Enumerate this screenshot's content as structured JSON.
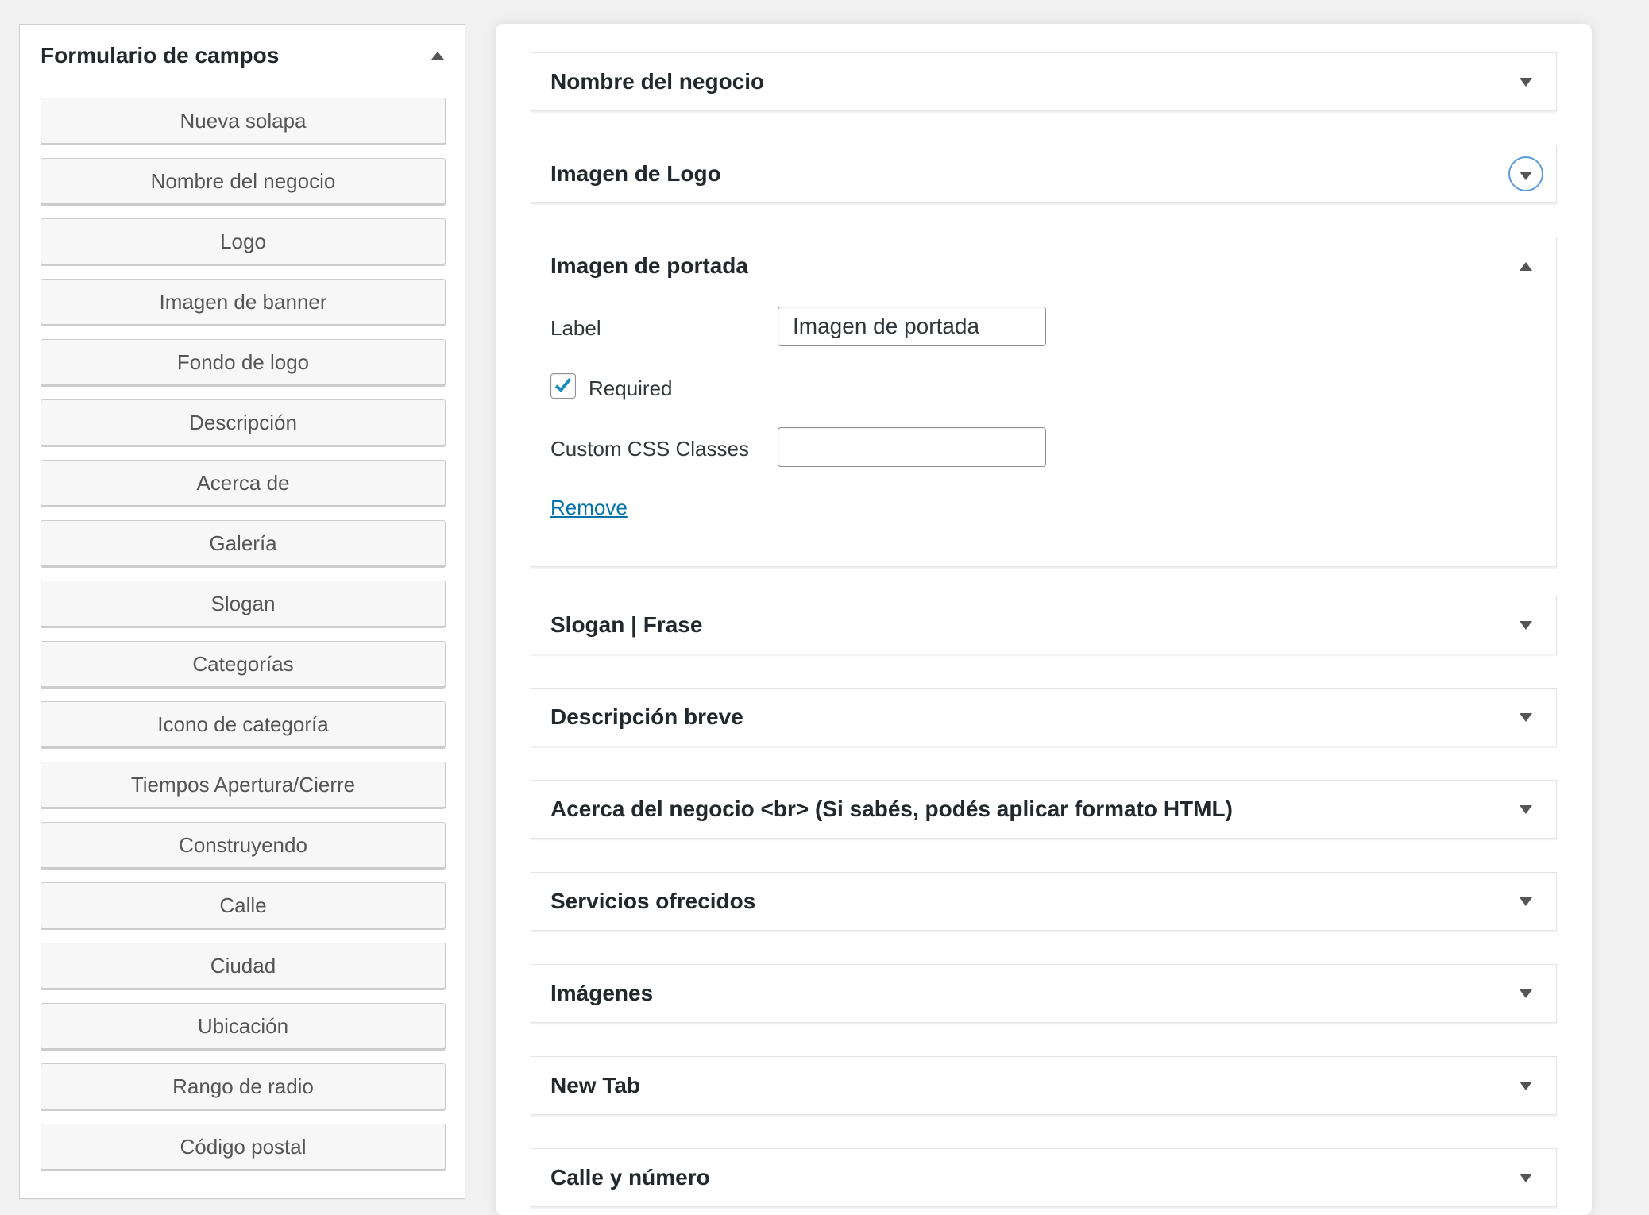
{
  "sidebar": {
    "title": "Formulario de campos",
    "buttons": [
      "Nueva solapa",
      "Nombre del negocio",
      "Logo",
      "Imagen de banner",
      "Fondo de logo",
      "Descripción",
      "Acerca de",
      "Galería",
      "Slogan",
      "Categorías",
      "Icono de categoría",
      "Tiempos Apertura/Cierre",
      "Construyendo",
      "Calle",
      "Ciudad",
      "Ubicación",
      "Rango de radio",
      "Código postal"
    ]
  },
  "fields": [
    {
      "title": "Nombre del negocio",
      "state": "collapsed"
    },
    {
      "title": "Imagen de Logo",
      "state": "collapsed-focused"
    },
    {
      "title": "Imagen de portada",
      "state": "expanded",
      "label_label": "Label",
      "label_value": "Imagen de portada",
      "required_label": "Required",
      "required_checked": true,
      "css_label": "Custom CSS Classes",
      "css_value": "",
      "remove_label": "Remove"
    },
    {
      "title": "Slogan | Frase",
      "state": "collapsed"
    },
    {
      "title": "Descripción breve",
      "state": "collapsed"
    },
    {
      "title": "Acerca del negocio <br> (Si sabés, podés aplicar formato HTML)",
      "state": "collapsed"
    },
    {
      "title": "Servicios ofrecidos",
      "state": "collapsed"
    },
    {
      "title": "Imágenes",
      "state": "collapsed"
    },
    {
      "title": "New Tab",
      "state": "collapsed"
    },
    {
      "title": "Calle y número",
      "state": "collapsed"
    }
  ],
  "colors": {
    "link": "#0073aa",
    "checkbox_mark": "#1e8cbe",
    "focus_ring": "#5b9dd9"
  }
}
